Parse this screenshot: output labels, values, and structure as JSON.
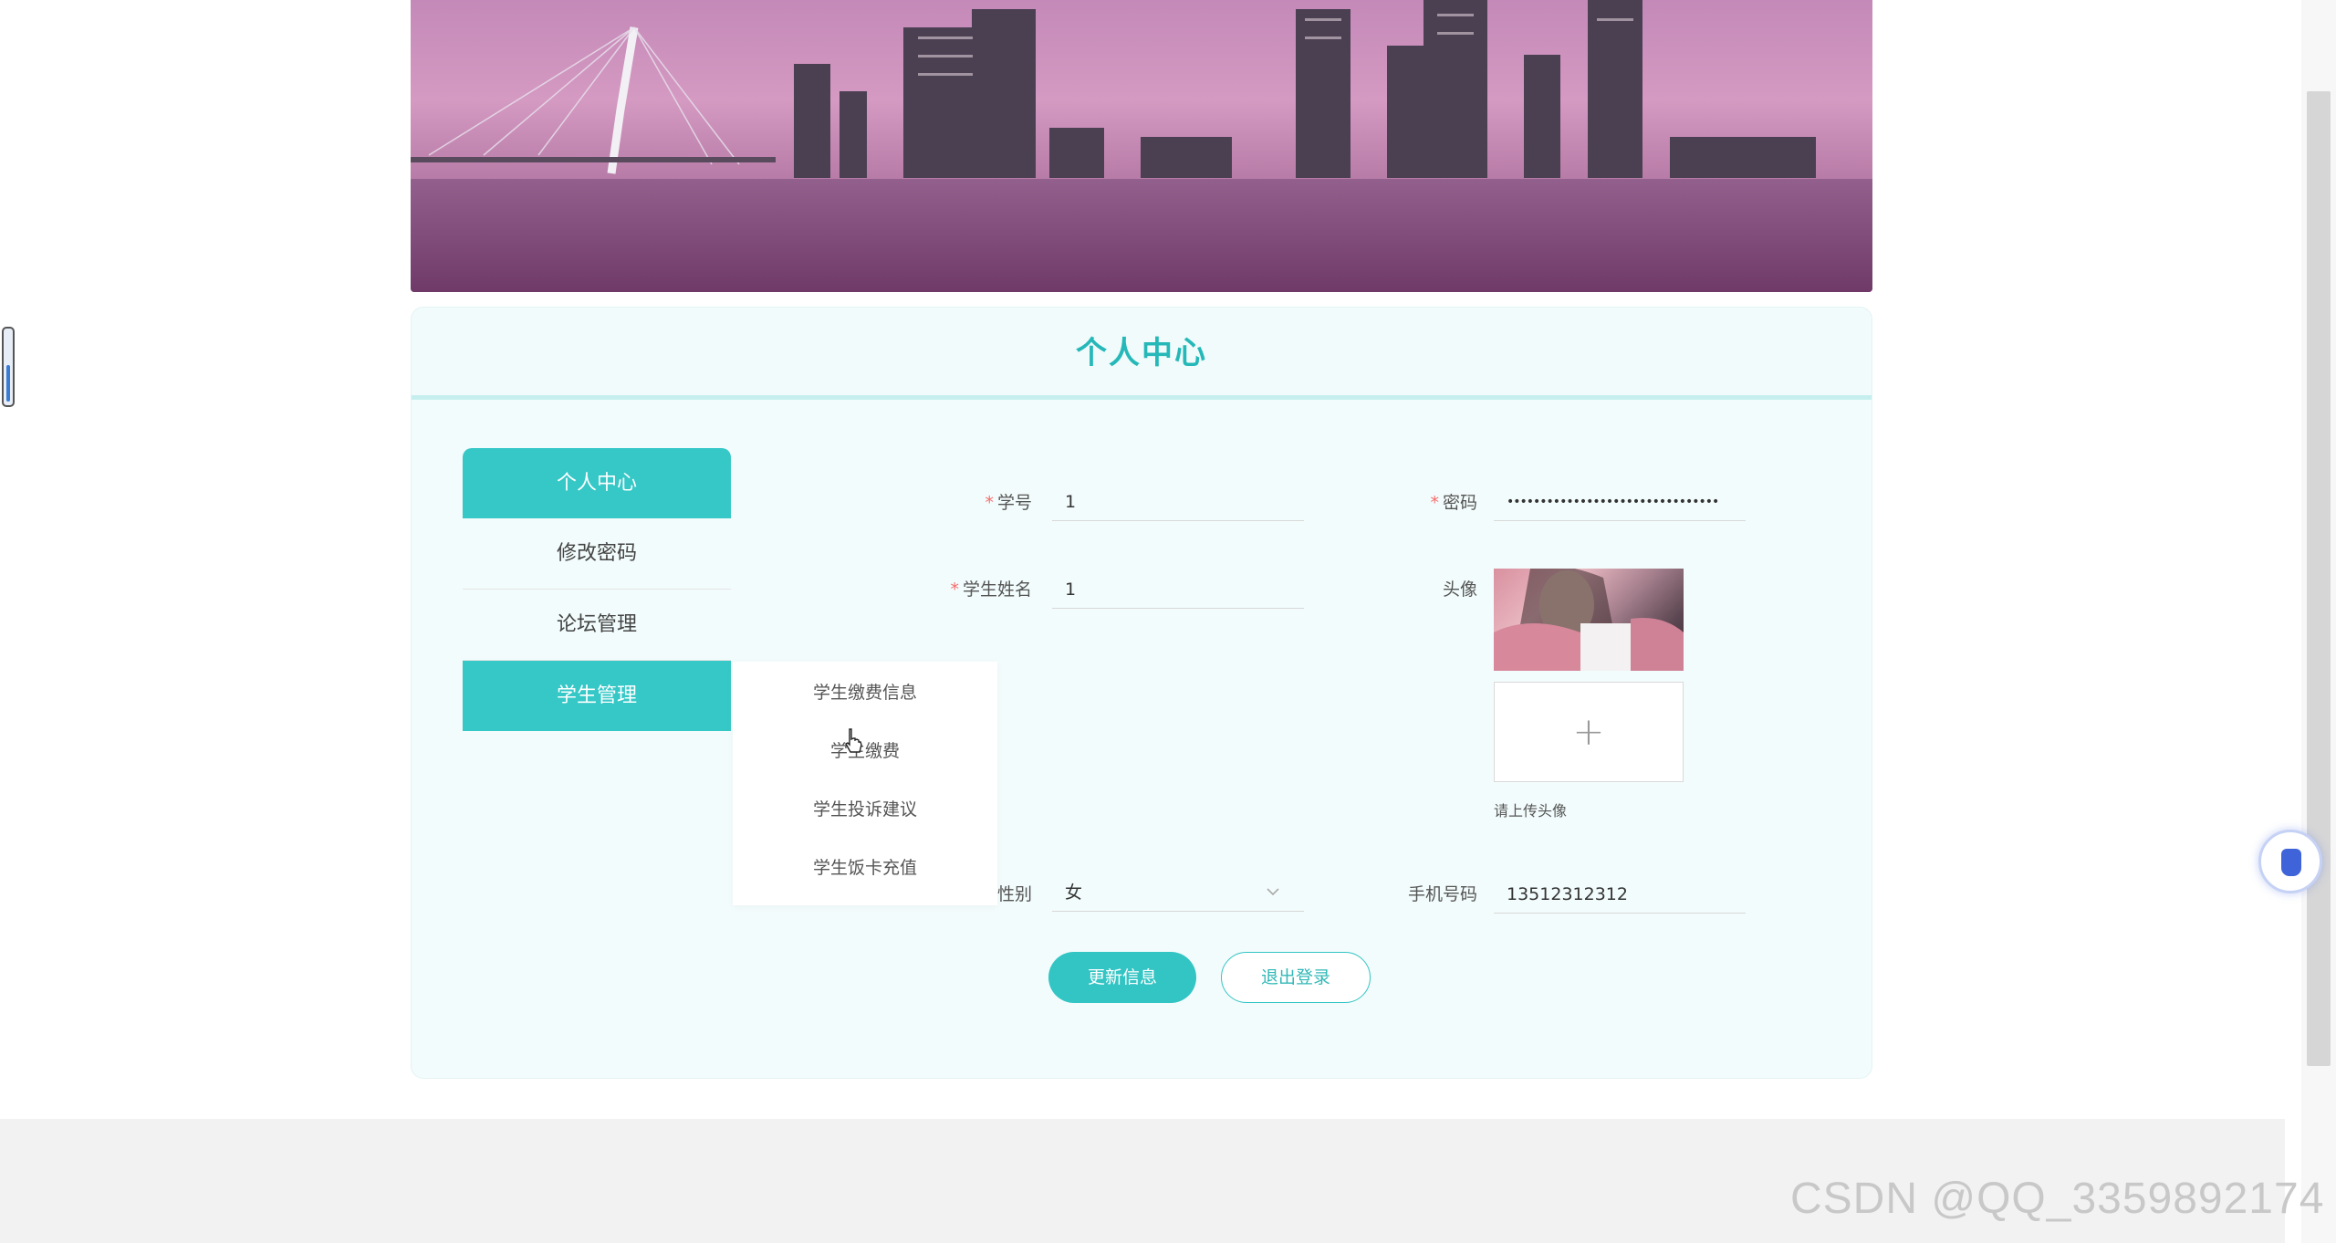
{
  "page": {
    "title": "个人中心"
  },
  "sidebar": {
    "items": [
      {
        "label": "个人中心",
        "active": true
      },
      {
        "label": "修改密码",
        "active": false
      },
      {
        "label": "论坛管理",
        "active": false
      },
      {
        "label": "学生管理",
        "active": true
      }
    ],
    "submenu": [
      {
        "label": "学生缴费信息"
      },
      {
        "label": "学生缴费"
      },
      {
        "label": "学生投诉建议"
      },
      {
        "label": "学生饭卡充值"
      }
    ]
  },
  "form": {
    "student_id": {
      "label": "学号",
      "value": "1",
      "required": true
    },
    "password": {
      "label": "密码",
      "value": "••••••••••••••••••••••••••••••••",
      "required": true
    },
    "student_name": {
      "label": "学生姓名",
      "value": "1",
      "required": true
    },
    "avatar": {
      "label": "头像",
      "upload_hint": "请上传头像",
      "upload_icon": "plus-icon"
    },
    "gender": {
      "label": "性别",
      "value": "女"
    },
    "phone": {
      "label": "手机号码",
      "value": "13512312312"
    }
  },
  "actions": {
    "update_label": "更新信息",
    "logout_label": "退出登录"
  },
  "watermark": "CSDN @QQ_3359892174",
  "colors": {
    "accent": "#36c7c7",
    "required": "#f56c6c",
    "title": "#26b8b8"
  }
}
